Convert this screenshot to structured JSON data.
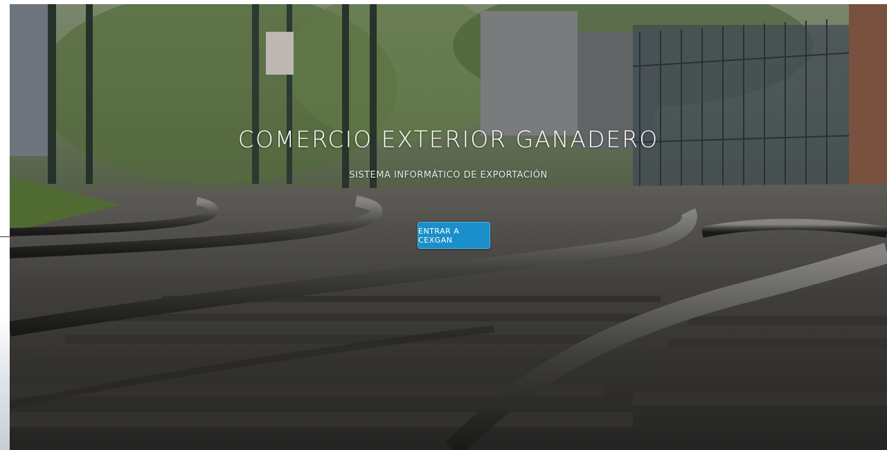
{
  "hero": {
    "title": "COMERCIO EXTERIOR GANADERO",
    "subtitle": "SISTEMA INFORMÁTICO DE EXPORTACIÓN",
    "cta_label": "ENTRAR A CEXGAN"
  },
  "colors": {
    "cta_background": "#1a8fc9",
    "title_text": "#ffffff"
  }
}
